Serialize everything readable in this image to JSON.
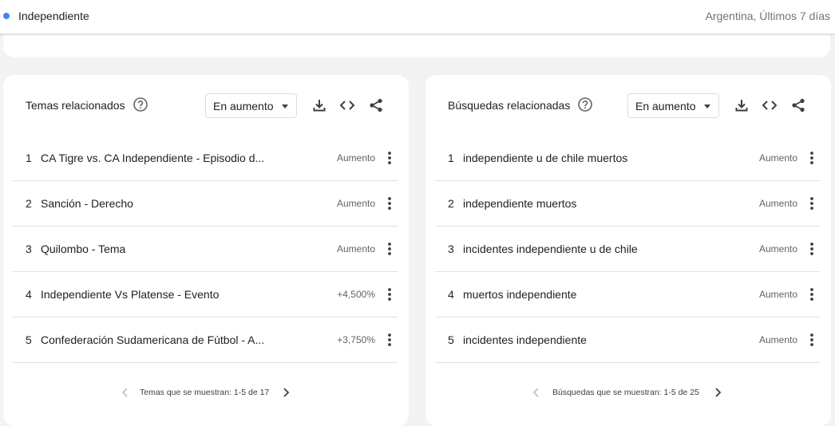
{
  "topbar": {
    "term": "Independiente",
    "meta": "Argentina, Últimos 7 días",
    "dot_color": "#4285f4"
  },
  "related_topics": {
    "title": "Temas relacionados",
    "dropdown_value": "En aumento",
    "rows": [
      {
        "rank": "1",
        "label": "CA Tigre vs. CA Independiente - Episodio d...",
        "value": "Aumento"
      },
      {
        "rank": "2",
        "label": "Sanción - Derecho",
        "value": "Aumento"
      },
      {
        "rank": "3",
        "label": "Quilombo - Tema",
        "value": "Aumento"
      },
      {
        "rank": "4",
        "label": "Independiente Vs Platense - Evento",
        "value": "+4,500%"
      },
      {
        "rank": "5",
        "label": "Confederación Sudamericana de Fútbol - A...",
        "value": "+3,750%"
      }
    ],
    "pager_text": "Temas que se muestran: 1-5 de 17"
  },
  "related_queries": {
    "title": "Búsquedas relacionadas",
    "dropdown_value": "En aumento",
    "rows": [
      {
        "rank": "1",
        "label": "independiente u de chile muertos",
        "value": "Aumento"
      },
      {
        "rank": "2",
        "label": "independiente muertos",
        "value": "Aumento"
      },
      {
        "rank": "3",
        "label": "incidentes independiente u de chile",
        "value": "Aumento"
      },
      {
        "rank": "4",
        "label": "muertos independiente",
        "value": "Aumento"
      },
      {
        "rank": "5",
        "label": "incidentes independiente",
        "value": "Aumento"
      }
    ],
    "pager_text": "Búsquedas que se muestran: 1-5 de 25"
  },
  "icons": {
    "help": "help-circle-icon",
    "download": "download-icon",
    "embed": "code-embed-icon",
    "share": "share-icon",
    "more": "more-vert-icon",
    "prev": "chevron-left-icon",
    "next": "chevron-right-icon"
  }
}
